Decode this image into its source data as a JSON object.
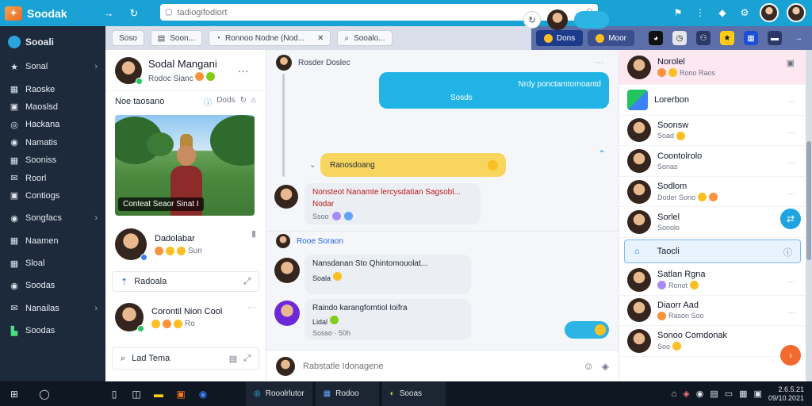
{
  "browser": {
    "title": "Soodak",
    "url_placeholder": "tadiogifodiort"
  },
  "sidebar": {
    "header": "Sooali",
    "items": [
      {
        "label": "Sonal",
        "icon": "star-icon",
        "chevron": true
      },
      {
        "label": "Raoske",
        "icon": "grid-icon",
        "chevron": false
      },
      {
        "label": "Maoslsd",
        "icon": "box-icon",
        "chevron": false
      },
      {
        "label": "Hackana",
        "icon": "circle-icon",
        "chevron": false
      },
      {
        "label": "Namatis",
        "icon": "circle-icon",
        "chevron": false
      },
      {
        "label": "Sooniss",
        "icon": "grid-icon",
        "chevron": false
      },
      {
        "label": "Roorl",
        "icon": "mail-icon",
        "chevron": false
      },
      {
        "label": "Contiogs",
        "icon": "box-icon",
        "chevron": false
      },
      {
        "label": "Songfacs",
        "icon": "circle-icon",
        "chevron": true
      },
      {
        "label": "Naamen",
        "icon": "grid-icon",
        "chevron": false
      },
      {
        "label": "Sloal",
        "icon": "grid-icon",
        "chevron": false
      },
      {
        "label": "Soodas",
        "icon": "circle-icon",
        "chevron": false
      },
      {
        "label": "Nanailas",
        "icon": "mail-icon",
        "chevron": true
      },
      {
        "label": "Soodas",
        "icon": "app-icon",
        "chevron": false
      }
    ]
  },
  "tabs": [
    {
      "label": "Soso"
    },
    {
      "label": "Soon..."
    },
    {
      "label": "Ronnoo Nodne (Nod..."
    },
    {
      "label": "Sooalo..."
    }
  ],
  "tab_right": {
    "pill1": "Dons",
    "pill2": "Moor"
  },
  "profile": {
    "name": "Sodal Mangani",
    "subtitle": "Rodoc Sianc",
    "section_title": "Noe taosano",
    "section_actions": "Dods",
    "photo_caption": "Conteat Seaor Sinat I",
    "card1_title": "Dadolabar",
    "card1_sub": "Sun",
    "link_row": "Radoala",
    "card2_title": "Corontil Nion Cool",
    "card2_sub": "Ro",
    "footer_label": "Lad Tema"
  },
  "chat": {
    "thread_title": "Rosder Doslec",
    "blue_msg_line1": "Nrdy ponctamtornoantd",
    "blue_msg_line2": "Sosds",
    "yellow_msg": "Ranosdoang",
    "msg1_line1": "Nonsteot Nanamte lercysdatian Sagsobl...",
    "msg1_line2": "Nodar",
    "msg1_time": "Ssoo",
    "section2_title": "Rooe Soraon",
    "msg2_line1": "Nansdanan Sto Qhintomouolat...",
    "msg2_line2": "Soala",
    "msg3_line1": "Raindo karangfomtiol Ioifra",
    "msg3_line2": "Lidal",
    "msg3_time": "Sosso · 50h",
    "composer_placeholder": "Rabstatle Idonagene"
  },
  "contacts": [
    {
      "name": "Norolel",
      "sub": "Rono Raos",
      "meta": ""
    },
    {
      "name": "Lorerbon",
      "sub": "",
      "meta": "..."
    },
    {
      "name": "Soonsw",
      "sub": "Soad",
      "meta": "..."
    },
    {
      "name": "Coontolrolo",
      "sub": "Sonas",
      "meta": "..."
    },
    {
      "name": "Sodlom",
      "sub": "Doder Sono",
      "meta": "..."
    },
    {
      "name": "Sorlel",
      "sub": "Sonolo",
      "meta": ""
    },
    {
      "name": "Taocli",
      "sub": "",
      "meta": ""
    },
    {
      "name": "Satlan Rgna",
      "sub": "Ronot",
      "meta": "..."
    },
    {
      "name": "Diaorr Aad",
      "sub": "Rason Soo",
      "meta": "..."
    },
    {
      "name": "Sonoo Comdonak",
      "sub": "Soo",
      "meta": ""
    }
  ],
  "taskbar": {
    "apps": [
      {
        "label": "Rooolrlutor",
        "icon": "chrome-icon"
      },
      {
        "label": "Rodoo",
        "icon": "window-icon"
      },
      {
        "label": "Sooas",
        "icon": "app-icon"
      }
    ],
    "clock_time": "2.6.5.21",
    "clock_date": "09/10.2021"
  },
  "colors": {
    "accent": "#1aa2d4",
    "sidebar_bg": "#1d2a3b",
    "bubble_blue": "#22b3e6",
    "bubble_yellow": "#f8d55e",
    "fab_orange": "#f26a2e"
  }
}
